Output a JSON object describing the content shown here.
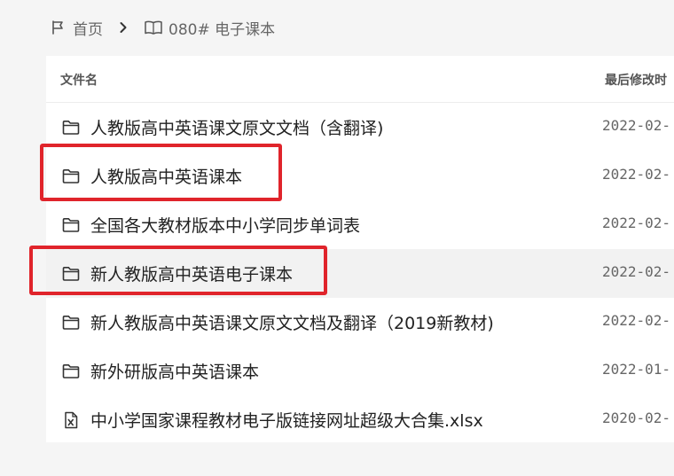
{
  "breadcrumb": {
    "home_label": "首页",
    "current_label": "080# 电子课本"
  },
  "table": {
    "col_name": "文件名",
    "col_modified": "最后修改时"
  },
  "files": [
    {
      "name": "人教版高中英语课文原文文档（含翻译)",
      "date": "2022-02-",
      "icon": "folder-icon"
    },
    {
      "name": "人教版高中英语课本",
      "date": "2022-02-",
      "icon": "folder-icon"
    },
    {
      "name": "全国各大教材版本中小学同步单词表",
      "date": "2022-02-",
      "icon": "folder-icon"
    },
    {
      "name": "新人教版高中英语电子课本",
      "date": "2022-02-",
      "icon": "folder-icon"
    },
    {
      "name": "新人教版高中英语课文原文文档及翻译（2019新教材)",
      "date": "2022-02-",
      "icon": "folder-icon"
    },
    {
      "name": "新外研版高中英语课本",
      "date": "2022-01-",
      "icon": "folder-icon"
    },
    {
      "name": "中小学国家课程教材电子版链接网址超级大合集.xlsx",
      "date": "2020-02-",
      "icon": "excel-file-icon"
    }
  ],
  "colors": {
    "highlight_box": "#e0242b",
    "row_highlight": "#f2f2f2",
    "page_bg": "#f5f5f5"
  }
}
